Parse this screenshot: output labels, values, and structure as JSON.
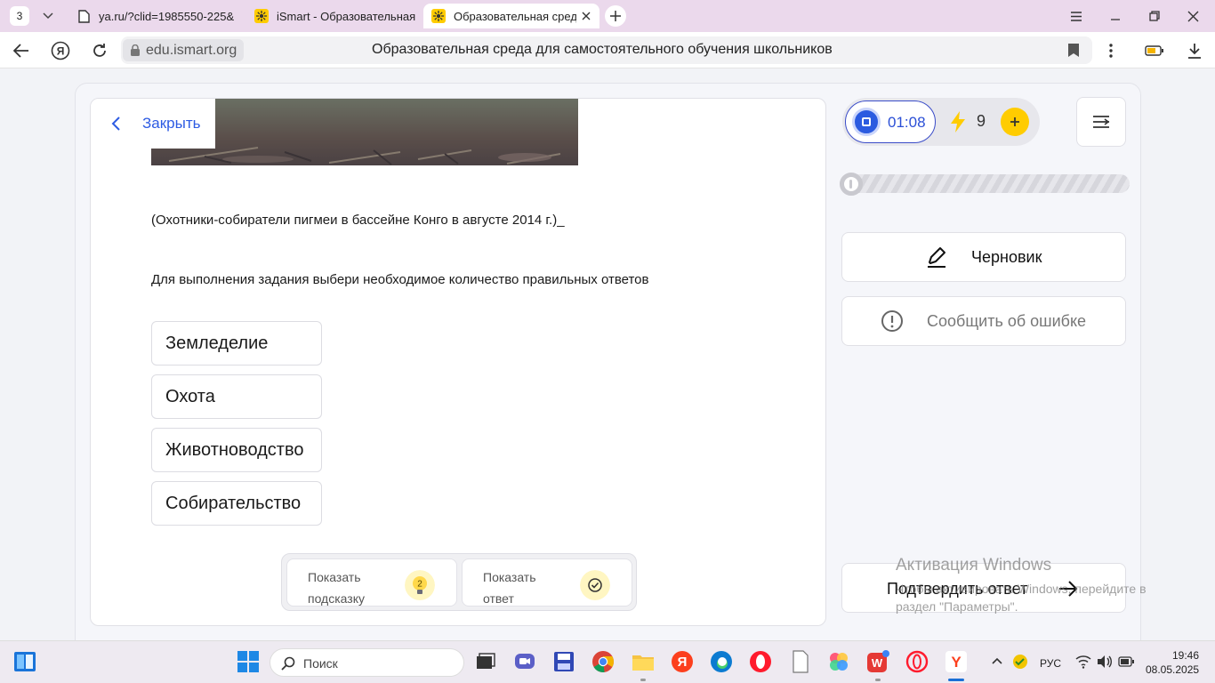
{
  "browser": {
    "tab_count": "3",
    "tabs": [
      {
        "label": "ya.ru/?clid=1985550-225&"
      },
      {
        "label": "iSmart - Образовательная"
      },
      {
        "label": "Образовательная среда"
      }
    ],
    "url_domain": "edu.ismart.org",
    "page_title": "Образовательная среда для самостоятельного обучения школьников"
  },
  "task": {
    "close_label": "Закрыть",
    "caption": "(Охотники-собиратели пигмеи в бассейне Конго в августе 2014 г.)_",
    "instruction": "Для выполнения задания выбери необходимое количество правильных ответов",
    "options": [
      "Земледелие",
      "Охота",
      "Животноводство",
      "Собирательство"
    ],
    "hint_button": {
      "label": "Показать подсказку",
      "count": "2"
    },
    "answer_button": {
      "label": "Показать ответ"
    }
  },
  "sidebar": {
    "timer": "01:08",
    "energy": "9",
    "progress": 0,
    "draft_label": "Черновик",
    "report_label": "Сообщить об ошибке",
    "confirm_label": "Подтвердить ответ"
  },
  "watermark": {
    "title": "Активация Windows",
    "text": "Чтобы активировать Windows, перейдите в раздел \"Параметры\"."
  },
  "taskbar": {
    "search_label": "Поиск",
    "language": "РУС",
    "time": "19:46",
    "date": "08.05.2025"
  },
  "colors": {
    "accent": "#2b5be0",
    "energy": "#ffcc00",
    "tab_strip": "#ebd9ec"
  }
}
